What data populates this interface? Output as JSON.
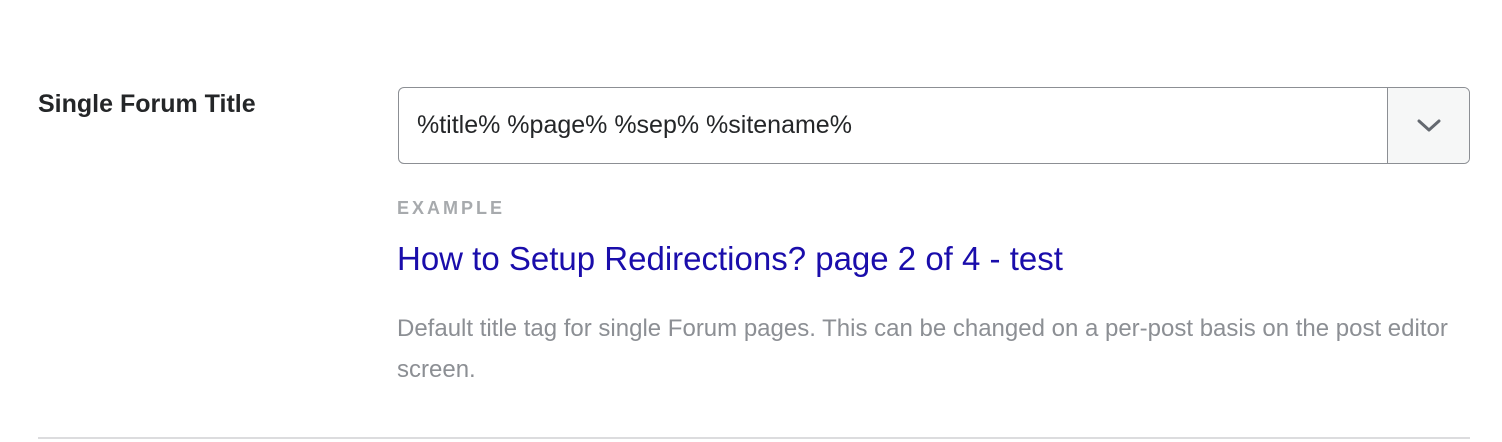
{
  "field": {
    "label": "Single Forum Title",
    "value": "%title% %page% %sep% %sitename%"
  },
  "example": {
    "label": "EXAMPLE",
    "text": "How to Setup Redirections? page 2 of 4 - test"
  },
  "description": "Default title tag for single Forum pages. This can be changed on a per-post basis on the post editor screen.",
  "icons": {
    "dropdown": "chevron-down-icon"
  },
  "colors": {
    "label": "#242628",
    "link": "#1a0dab",
    "muted": "#8c8f94",
    "example_label": "#a7aaad",
    "border": "#8c8f94"
  }
}
